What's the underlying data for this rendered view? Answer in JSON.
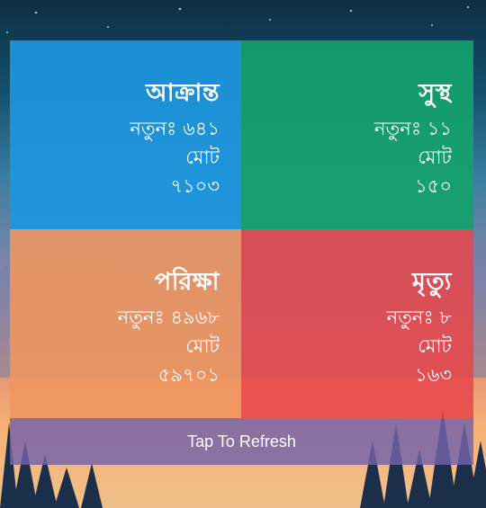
{
  "cards": {
    "infected": {
      "title": "আক্রান্ত",
      "new_label": "নতুনঃ",
      "new_value": "৬৪১",
      "total_label": "মোট",
      "total_value": "৭১০৩"
    },
    "recovered": {
      "title": "সুস্থ",
      "new_label": "নতুনঃ",
      "new_value": "১১",
      "total_label": "মোট",
      "total_value": "১৫০"
    },
    "tests": {
      "title": "পরিক্ষা",
      "new_label": "নতুনঃ",
      "new_value": "৪৯৬৮",
      "total_label": "মোট",
      "total_value": "৫৯৭০১"
    },
    "deaths": {
      "title": "মৃত্যু",
      "new_label": "নতুনঃ",
      "new_value": "৮",
      "total_label": "মোট",
      "total_value": "১৬৩"
    }
  },
  "refresh_label": "Tap To Refresh",
  "colors": {
    "infected": "#1c96de",
    "recovered": "#14a06e",
    "tests": "#f0965f",
    "deaths": "#e8464b",
    "refresh": "#7362aa"
  }
}
